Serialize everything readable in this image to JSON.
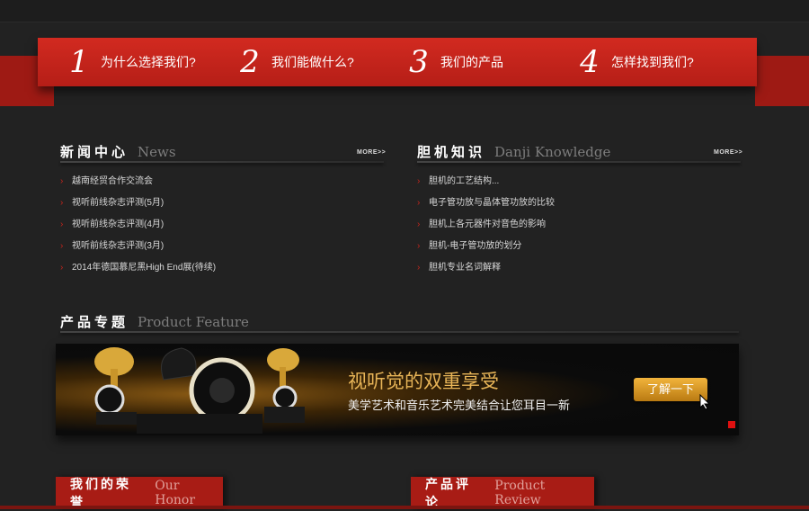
{
  "nav_tabs": [
    {
      "number": "1",
      "label": "为什么选择我们?"
    },
    {
      "number": "2",
      "label": "我们能做什么?"
    },
    {
      "number": "3",
      "label": "我们的产品"
    },
    {
      "number": "4",
      "label": "怎样找到我们?"
    }
  ],
  "news": {
    "title_cn": "新闻中心",
    "title_en": "News",
    "more": "MORE>>",
    "items": [
      "越南经贸合作交流会",
      "视听前线杂志评测(5月)",
      "视听前线杂志评测(4月)",
      "视听前线杂志评测(3月)",
      "2014年德国慕尼黑High End展(待续)"
    ]
  },
  "knowledge": {
    "title_cn": "胆机知识",
    "title_en": "Danji Knowledge",
    "more": "MORE>>",
    "items": [
      "胆机的工艺结构...",
      "电子管功放与晶体管功放的比较",
      "胆机上各元器件对音色的影响",
      "胆机-电子管功放的划分",
      "胆机专业名词解释"
    ]
  },
  "feature": {
    "title_cn": "产品专题",
    "title_en": "Product Feature",
    "banner_headline": "视听觉的双重享受",
    "banner_sub": "美学艺术和音乐艺术完美结合让您耳目一新",
    "banner_button": "了解一下"
  },
  "honor": {
    "title_cn": "我们的荣誉",
    "title_en": "Our Honor"
  },
  "review": {
    "title_cn": "产品评论",
    "title_en": "Product Review"
  },
  "colors": {
    "accent_red": "#c8251c",
    "banner_gold": "#e7b457",
    "background": "#222222"
  }
}
